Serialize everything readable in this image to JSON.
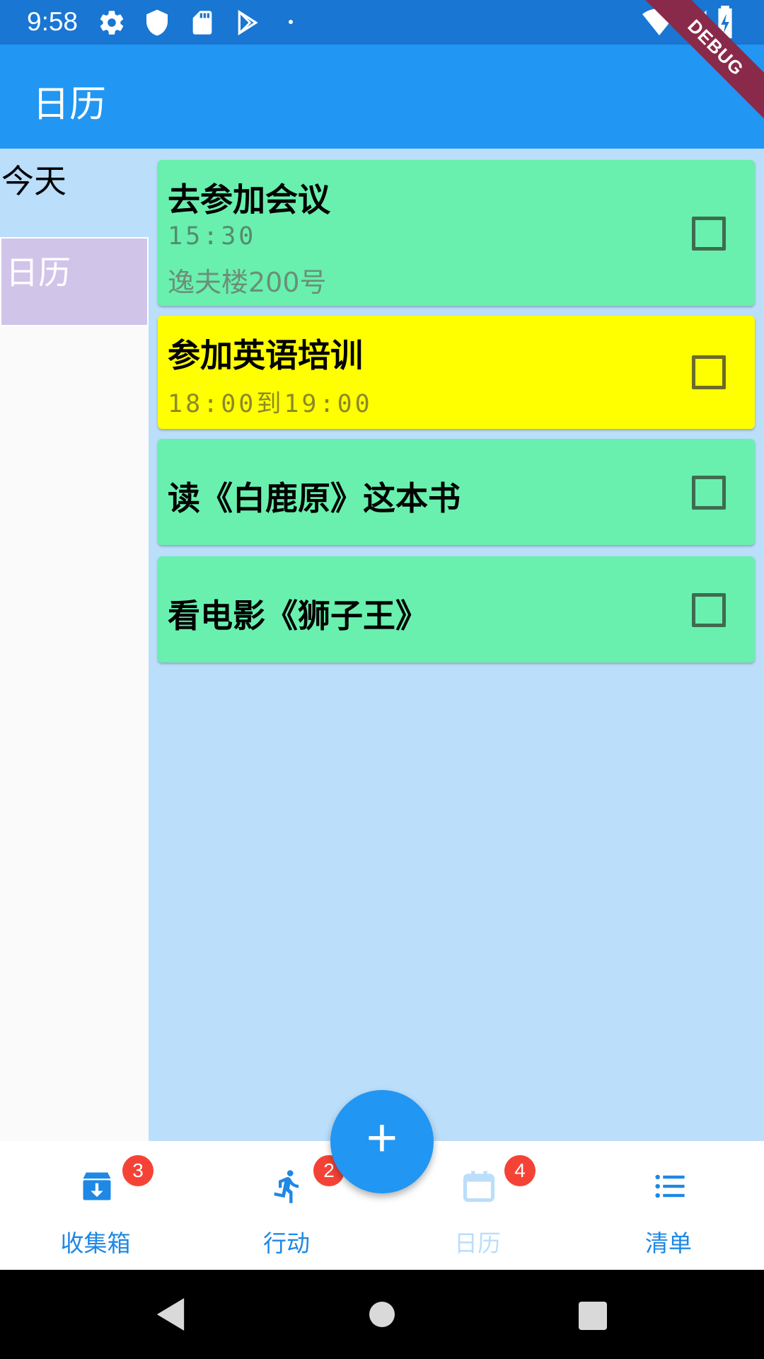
{
  "status_bar": {
    "time": "9:58",
    "icons": [
      "settings-icon",
      "shield-icon",
      "sd-card-icon",
      "play-store-icon",
      "dot-icon",
      "wifi-icon",
      "signal-icon",
      "battery-charging-icon"
    ],
    "debug_banner": "DEBUG",
    "color": "#1976D2"
  },
  "app_bar": {
    "title": "日历",
    "color": "#2196F3"
  },
  "sidebar": {
    "items": [
      {
        "label": "今天",
        "selected": false
      },
      {
        "label": "日历",
        "selected": true
      }
    ]
  },
  "tasks": [
    {
      "title": "去参加会议",
      "time": "15:30",
      "location": "逸夫楼200号",
      "color": "#69F0AE",
      "checked": false
    },
    {
      "title": "参加英语培训",
      "time": "18:00到19:00",
      "color": "#FFFF00",
      "checked": false
    },
    {
      "title": "读《白鹿原》这本书",
      "color": "#69F0AE",
      "checked": false
    },
    {
      "title": "看电影《狮子王》",
      "color": "#69F0AE",
      "checked": false
    }
  ],
  "fab": {
    "label": "+",
    "icon": "add-icon"
  },
  "bottom_nav": {
    "items": [
      {
        "label": "收集箱",
        "icon": "inbox-icon",
        "badge": "3",
        "active": true
      },
      {
        "label": "行动",
        "icon": "running-icon",
        "badge": "2",
        "active": true
      },
      {
        "label": "日历",
        "icon": "calendar-icon",
        "badge": "4",
        "active": false
      },
      {
        "label": "清单",
        "icon": "list-icon",
        "active": true
      }
    ],
    "active_color": "#1E88E5",
    "inactive_color": "#BBDEFB"
  },
  "system_nav": [
    "back-icon",
    "home-icon",
    "recents-icon"
  ]
}
